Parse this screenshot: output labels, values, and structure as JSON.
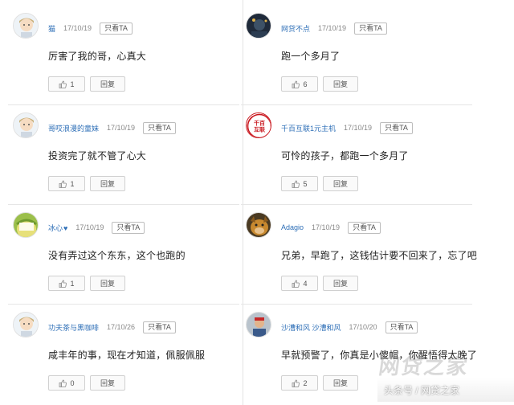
{
  "left_comments": [
    {
      "user": "猫",
      "date": "17/10/19",
      "only_ta": "只看TA",
      "text": "厉害了我的哥，心真大",
      "likes": "1",
      "reply": "回复",
      "avatar": "cartoon-boy"
    },
    {
      "user": "哥哎浪漫的童妹",
      "date": "17/10/19",
      "only_ta": "只看TA",
      "text": "投资完了就不管了心大",
      "likes": "1",
      "reply": "回复",
      "avatar": "cartoon-boy"
    },
    {
      "user": "冰心",
      "date": "17/10/19",
      "only_ta": "只看TA",
      "text": "没有弄过这个东东，这个也跑的",
      "likes": "1",
      "reply": "回复",
      "avatar": "green-yellow"
    },
    {
      "user": "功夫茶与黑咖啡",
      "date": "17/10/26",
      "only_ta": "只看TA",
      "text": "咸丰年的事，现在才知道，佩服佩服",
      "likes": "0",
      "reply": "回复",
      "avatar": "cartoon-boy"
    }
  ],
  "right_comments": [
    {
      "user": "网贷不点",
      "date": "17/10/19",
      "only_ta": "只看TA",
      "text": "跑一个多月了",
      "likes": "6",
      "reply": "回复",
      "avatar": "dark-photo"
    },
    {
      "user": "千百互联1元主机",
      "date": "17/10/19",
      "only_ta": "只看TA",
      "text": "可怜的孩子，都跑一个多月了",
      "likes": "5",
      "reply": "回复",
      "avatar": "red-logo",
      "avatar_text": "千百互联"
    },
    {
      "user": "Adagio",
      "date": "17/10/19",
      "only_ta": "只看TA",
      "text": "兄弟，早跑了，这钱估计要不回来了，忘了吧",
      "likes": "4",
      "reply": "回复",
      "avatar": "dog-photo"
    },
    {
      "user": "沙漕和风 沙漕和风",
      "date": "17/10/20",
      "only_ta": "只看TA",
      "text": "早就预警了，你真是小傻帽，你醒悟得太晚了",
      "likes": "2",
      "reply": "回复",
      "avatar": "person-photo"
    }
  ],
  "watermark": {
    "logo": "网贷之家",
    "text": "头条号 / 网贷之家"
  },
  "colors": {
    "username": "#2e6fb7",
    "border": "#d0d0d0",
    "divider": "#e3e3e3"
  }
}
